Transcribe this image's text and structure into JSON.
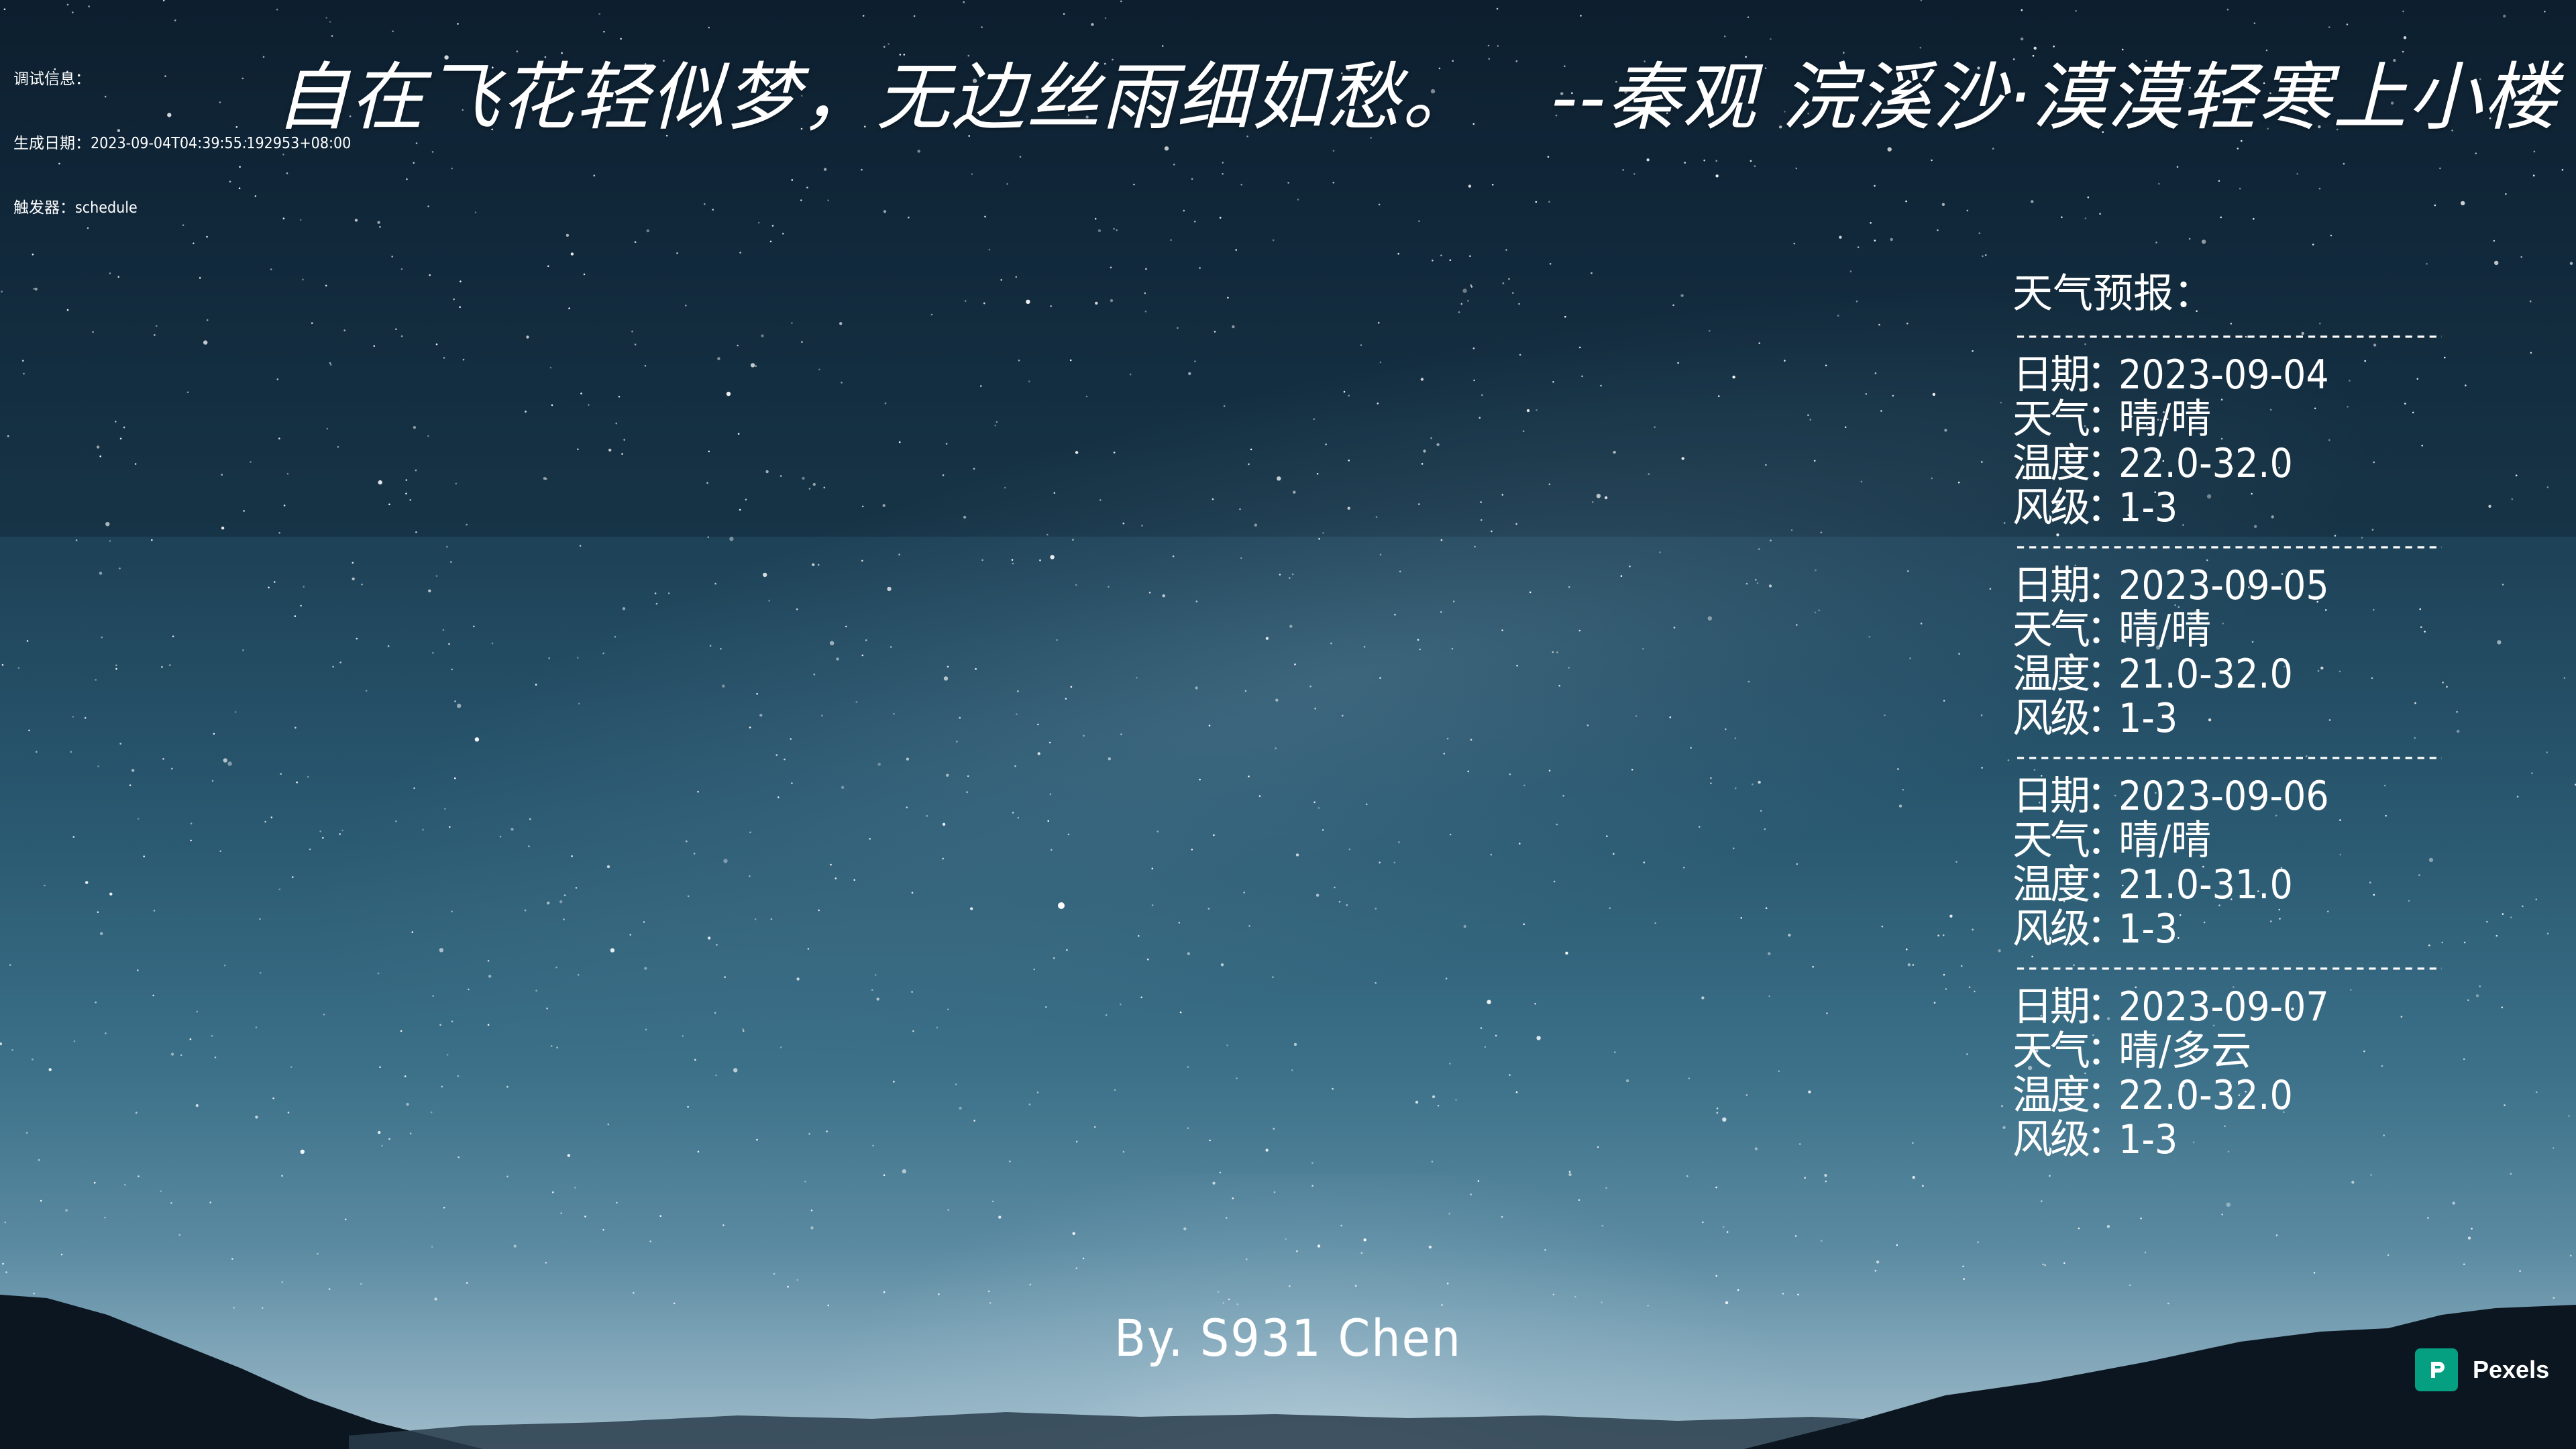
{
  "debug": {
    "title": "调试信息：",
    "generated_label": "生成日期：",
    "generated_value": "2023-09-04T04:39:55.192953+08:00",
    "trigger_label": "触发器：",
    "trigger_value": "schedule"
  },
  "poem": {
    "text": "自在飞花轻似梦，无边丝雨细如愁。",
    "attribution": "--秦观 浣溪沙·漠漠轻寒上小楼"
  },
  "weather": {
    "title": "天气预报：",
    "divider": "----------------------------------------",
    "labels": {
      "date": "日期",
      "weather": "天气",
      "temp": "温度",
      "wind": "风级",
      "sep": "："
    },
    "days": [
      {
        "date": "2023-09-04",
        "weather": "晴/晴",
        "temp": "22.0-32.0",
        "wind": "1-3"
      },
      {
        "date": "2023-09-05",
        "weather": "晴/晴",
        "temp": "21.0-32.0",
        "wind": "1-3"
      },
      {
        "date": "2023-09-06",
        "weather": "晴/晴",
        "temp": "21.0-31.0",
        "wind": "1-3"
      },
      {
        "date": "2023-09-07",
        "weather": "晴/多云",
        "temp": "22.0-32.0",
        "wind": "1-3"
      }
    ]
  },
  "signature": "By. S931 Chen",
  "credit": {
    "name": "Pexels",
    "brand_color": "#05a081",
    "icon": "pexels-logo-icon"
  }
}
